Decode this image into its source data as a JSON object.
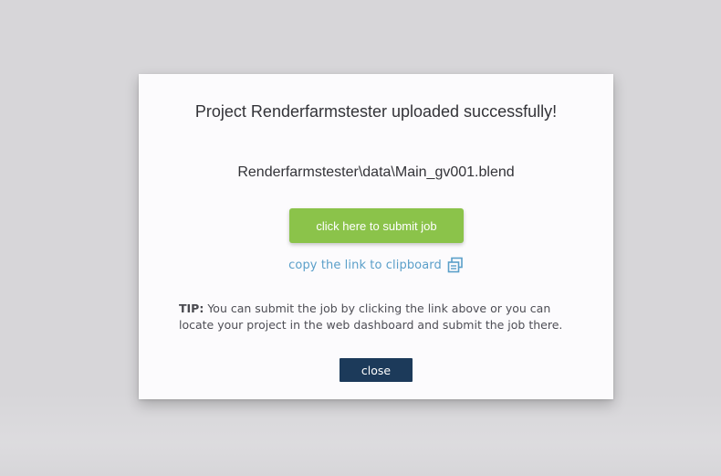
{
  "dialog": {
    "title": "Project Renderfarmstester uploaded successfully!",
    "file_path": "Renderfarmstester\\data\\Main_gv001.blend",
    "submit_label": "click here to submit job",
    "copy_link_label": "copy the link to clipboard",
    "copy_icon": "copy-icon",
    "tip_label": "TIP:",
    "tip_text": " You can submit the job by clicking the link above or you can locate your project in the web dashboard and submit the job there.",
    "close_label": "close"
  },
  "colors": {
    "background": "#d7d6d9",
    "dialog_bg": "#fcfbfd",
    "submit_green": "#8bc34a",
    "link_blue": "#5a9fc9",
    "close_navy": "#1c3a5a"
  }
}
